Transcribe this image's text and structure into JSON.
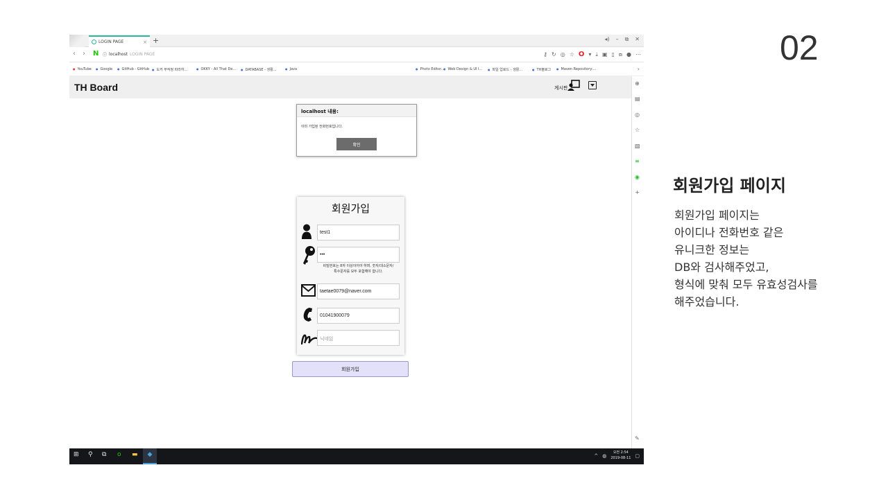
{
  "slide": {
    "number": "02",
    "heading": "회원가입 페이지",
    "description_lines": [
      "회원가입 페이지는",
      "아이디나 전화번호 같은",
      "유니크한 정보는",
      "DB와 검사해주었고,",
      "형식에 맞춰 모두 유효성검사를",
      "해주었습니다."
    ]
  },
  "browser": {
    "tab_title": "LOGIN PAGE",
    "url_host": "localhost",
    "url_path": "LOGIN PAGE",
    "bookmarks": [
      "YouTube",
      "Google",
      "GitHub - GitHub",
      "도커 무작정 따라하...",
      "OKKY - All That De...",
      "DATABASE - 생활...",
      "Java",
      "Photo Editor...",
      "Web Design & UI I...",
      "파일 업로드 - 생활...",
      "TH블로그",
      "Maven Repository:..."
    ]
  },
  "page": {
    "brand": "TH Board",
    "board_label": "게시판",
    "signup": {
      "title": "회원가입",
      "id_value": "test1",
      "password_value": "•••",
      "password_hint_line1": "비밀번호는 8자 이상이어야 하며, 숫자/대소문자/",
      "password_hint_line2": "특수문자를 모두 포함해야 합니다.",
      "email_value": "taetae0079@naver.com",
      "phone_value": "01041900079",
      "nickname_placeholder": "닉네임",
      "submit_label": "회원가입"
    },
    "dialog": {
      "title": "localhost 내용:",
      "message": "이미 가입된 전화번호입니다.",
      "ok_label": "확인"
    }
  },
  "taskbar": {
    "time": "오전 2:54",
    "date": "2019-08-11"
  },
  "colors": {
    "tab_accent": "#2db39e",
    "submit_bg": "#e3e1fa",
    "dialog_button": "#6c6c6c",
    "taskbar": "#15161a"
  }
}
